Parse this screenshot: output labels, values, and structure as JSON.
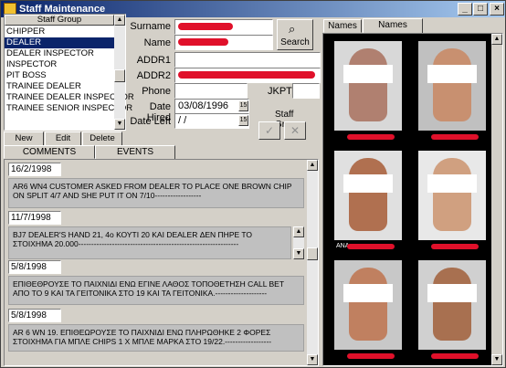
{
  "window": {
    "title": "Staff Maintenance",
    "controls": {
      "minimize": "_",
      "maximize": "□",
      "close": "×"
    }
  },
  "staff_group": {
    "header": "Staff Group",
    "items": [
      "CHIPPER",
      "DEALER",
      "DEALER INSPECTOR",
      "INSPECTOR",
      "PIT BOSS",
      "TRAINEE DEALER",
      "TRAINEE DEALER INSPECTOR",
      "TRAINEE SENIOR INSPECTOR"
    ],
    "selected_index": 1,
    "buttons": {
      "new_group": "New Group",
      "edit": "Edit",
      "delete": "Delete"
    }
  },
  "form": {
    "surname_label": "Surname",
    "name_label": "Name",
    "addr1_label": "ADDR1",
    "addr2_label": "ADDR2",
    "phone_label": "Phone",
    "jkpt_label": "JKPT",
    "date_hired_label": "Date Hired",
    "date_hired_value": "03/08/1996",
    "date_left_label": "Date Left",
    "date_left_value": " /  /",
    "search_label": "Search",
    "staff_group_label": "Staff Group",
    "ok_icon": "check-icon",
    "cancel_icon": "x-icon",
    "calendar_icon": "calendar-icon",
    "calendar_glyph": "15"
  },
  "tabs_bottom": {
    "comments": "COMMENTS",
    "events": "EVENTS"
  },
  "events": [
    {
      "date": "16/2/1998",
      "text": "AR6 WN4 CUSTOMER ASKED FROM DEALER TO PLACE ONE BROWN CHIP ON SPLIT 4/7 AND SHE PUT IT ON 7/10------------------"
    },
    {
      "date": "11/7/1998",
      "text": "BJ7 DEALER'S HAND 21, 4o ΚΟΥΤΙ 20 ΚΑΙ DEALER ΔΕΝ ΠΗΡΕ ΤΟ ΣΤΟΙΧΗΜΑ 20.000--------------------------------------------------------------"
    },
    {
      "date": "5/8/1998",
      "text": "ΕΠΙΘΕΘΡΟΥΣΕ ΤΟ ΠΑΙΧΝΙΔΙ ΕΝΩ ΕΓΙΝΕ ΛΑΘΟΣ ΤΟΠΟΘΕΤΗΣΗ CALL BET ΑΠΟ ΤΟ 9 ΚΑΙ ΤΑ ΓΕΙΤΟΝΙΚΑ ΣΤΟ 19 ΚΑΙ ΤΑ ΓΕΙΤΟΝΙΚΑ.--------------------"
    },
    {
      "date": "5/8/1998",
      "text": "AR 6 WN 19. ΕΠΙΘΕΩΡΟΥΣΕ ΤΟ ΠΑΙΧΝΙΔΙ ΕΝΩ ΠΛΗΡΩΘΗΚΕ 2 ΦΟΡΕΣ ΣΤΟΙΧΗΜΑ ΓΙΑ ΜΠΛΕ CHIPS 1 Χ ΜΠΛΕ ΜΑΡΚΑ ΣΤΟ 19/22.------------------"
    }
  ],
  "photo_tabs": {
    "names": "Names",
    "names_fotos": "Names &Fotos"
  },
  "photos": [
    {
      "caption": "",
      "skin": "#b08070",
      "bg": "#d8d8d8"
    },
    {
      "caption": "",
      "skin": "#c89070",
      "bg": "#c0c0c0"
    },
    {
      "caption": "ANA",
      "skin": "#b07050",
      "bg": "#e0e0e0"
    },
    {
      "caption": "",
      "skin": "#d0a080",
      "bg": "#e8e8e8"
    },
    {
      "caption": "",
      "skin": "#c08060",
      "bg": "#c8c8c8"
    },
    {
      "caption": "",
      "skin": "#a87050",
      "bg": "#d0d0d0"
    }
  ],
  "colors": {
    "titlebar": "#0a246a",
    "selection": "#0a246a",
    "redaction": "#e0102a"
  }
}
